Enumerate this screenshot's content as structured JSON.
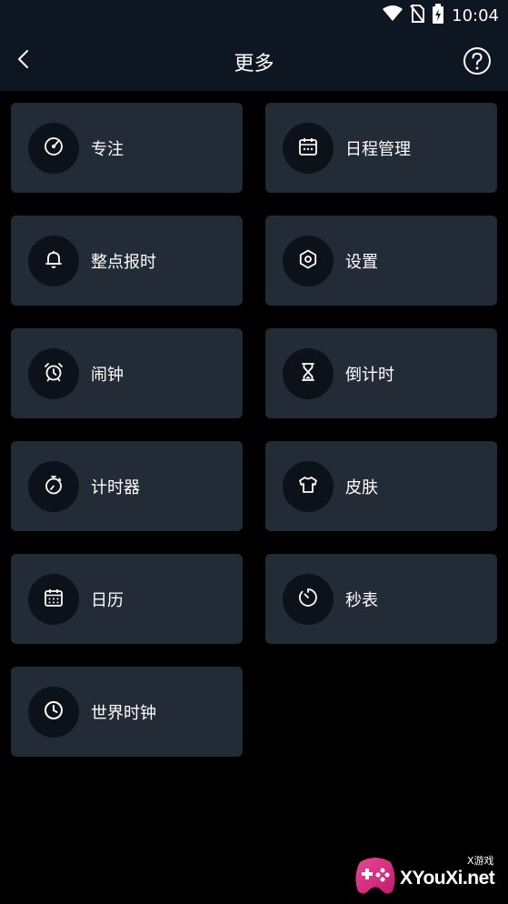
{
  "status_bar": {
    "time": "10:04",
    "icons": [
      "wifi-icon",
      "no-sim-icon",
      "battery-charging-icon"
    ]
  },
  "header": {
    "title": "更多",
    "back_icon": "chevron-left-icon",
    "help_icon": "help-circle-icon"
  },
  "menu": [
    {
      "label": "专注",
      "icon": "focus-icon"
    },
    {
      "label": "日程管理",
      "icon": "schedule-icon"
    },
    {
      "label": "整点报时",
      "icon": "bell-icon"
    },
    {
      "label": "设置",
      "icon": "gear-icon"
    },
    {
      "label": "闹钟",
      "icon": "alarm-clock-icon"
    },
    {
      "label": "倒计时",
      "icon": "hourglass-icon"
    },
    {
      "label": "计时器",
      "icon": "timer-icon"
    },
    {
      "label": "皮肤",
      "icon": "shirt-icon"
    },
    {
      "label": "日历",
      "icon": "calendar-icon"
    },
    {
      "label": "秒表",
      "icon": "stopwatch-icon"
    },
    {
      "label": "世界时钟",
      "icon": "clock-icon"
    }
  ],
  "watermark": {
    "brand": "XYouXi.net",
    "sub": "X游戏"
  },
  "colors": {
    "background": "#000000",
    "header": "#0e1622",
    "card": "#232b36",
    "icon_circle": "#0b121a"
  }
}
